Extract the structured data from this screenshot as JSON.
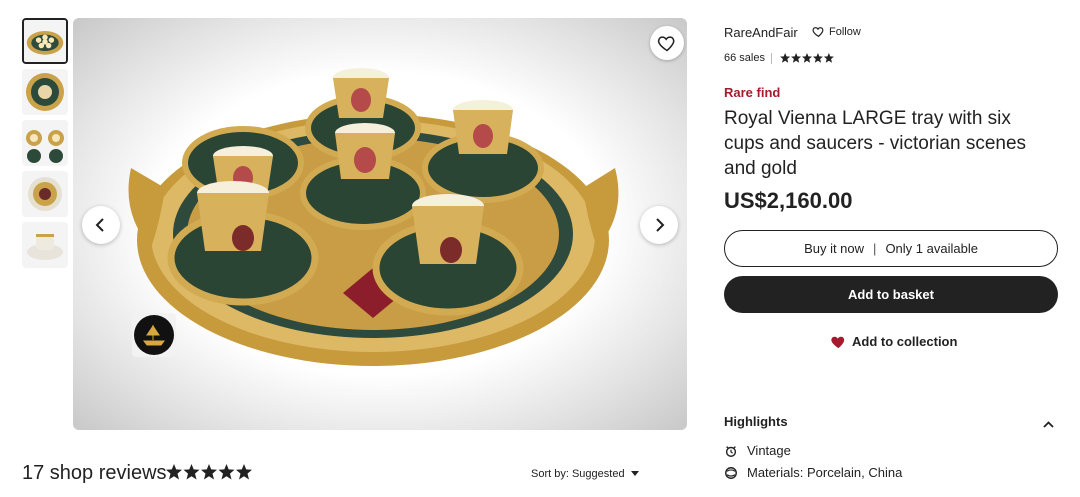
{
  "gallery": {
    "thumbnails": [
      {
        "label": "thumb-1",
        "active": true
      },
      {
        "label": "thumb-2",
        "active": false
      },
      {
        "label": "thumb-3",
        "active": false
      },
      {
        "label": "thumb-4",
        "active": false
      },
      {
        "label": "thumb-5",
        "active": false
      }
    ],
    "favorite_icon": "heart-outline-icon",
    "prev_icon": "chevron-left-icon",
    "next_icon": "chevron-right-icon"
  },
  "reviews": {
    "title": "17 shop reviews",
    "rating": 5,
    "sort_label": "Sort by: Suggested"
  },
  "shop": {
    "name": "RareAndFair",
    "follow_label": "Follow",
    "sales": "66 sales",
    "rating": 5
  },
  "listing": {
    "badge": "Rare find",
    "title": "Royal Vienna LARGE tray with six cups and saucers - victorian scenes and gold",
    "price": "US$2,160.00"
  },
  "actions": {
    "buy_now": "Buy it now",
    "availability": "Only 1 available",
    "add_to_basket": "Add to basket",
    "add_to_collection": "Add to collection"
  },
  "highlights": {
    "title": "Highlights",
    "items": [
      {
        "icon": "vintage-icon",
        "text": "Vintage"
      },
      {
        "icon": "materials-icon",
        "text": "Materials: Porcelain, China"
      }
    ]
  },
  "colors": {
    "accent_red": "#a61a2e",
    "primary_dark": "#222222"
  }
}
